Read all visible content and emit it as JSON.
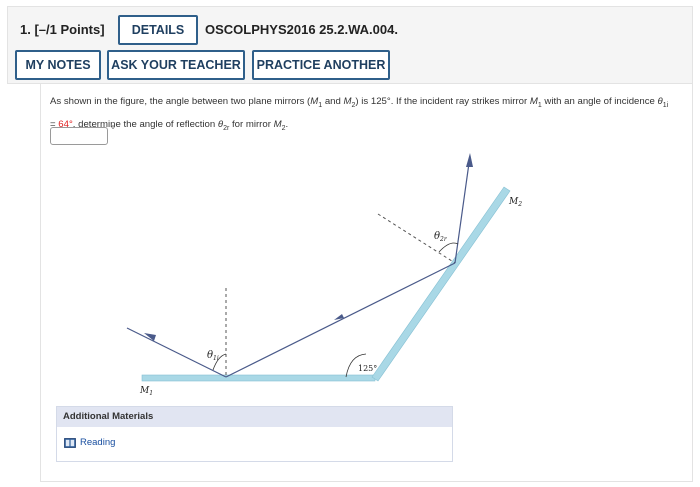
{
  "header": {
    "question_number": "1. [–/1 Points]",
    "details_label": "DETAILS",
    "problem_code": "OSCOLPHYS2016 25.2.WA.004.",
    "my_notes_label": "MY NOTES",
    "ask_teacher_label": "ASK YOUR TEACHER",
    "practice_label": "PRACTICE ANOTHER"
  },
  "question": {
    "part1": "As shown in the figure, the angle between two plane mirrors (",
    "m1": "M",
    "m1_sub": "1",
    "and": " and ",
    "m2": "M",
    "m2_sub": "2",
    "part2": ") is 125°. If the incident ray strikes mirror ",
    "m1b": "M",
    "m1b_sub": "1",
    "part3": " with an angle of incidence ",
    "theta1": "θ",
    "theta1_sub": "1i",
    "eq": " = ",
    "theta1_value": "64°",
    "part4": ", determine the angle of reflection ",
    "theta2": "θ",
    "theta2_sub": "2r",
    "part5": " for mirror ",
    "m2b": "M",
    "m2b_sub": "2",
    "end": "."
  },
  "answer": {
    "value": "",
    "unit": "°"
  },
  "figure": {
    "label_m1": "M",
    "label_m1_sub": "1",
    "label_m2": "M",
    "label_m2_sub": "2",
    "label_angle": "125°",
    "label_theta1": "θ",
    "label_theta1_sub": "1i",
    "label_theta2": "θ",
    "label_theta2_sub": "2r"
  },
  "additional_materials": {
    "title": "Additional Materials",
    "reading_label": "Reading",
    "reading_icon": "book-icon"
  },
  "colors": {
    "button_border": "#2f5f8a",
    "mirror": "#a9d8e6",
    "ray": "#4a5a8a",
    "red_value": "#e02020",
    "link": "#1a4fa0"
  }
}
